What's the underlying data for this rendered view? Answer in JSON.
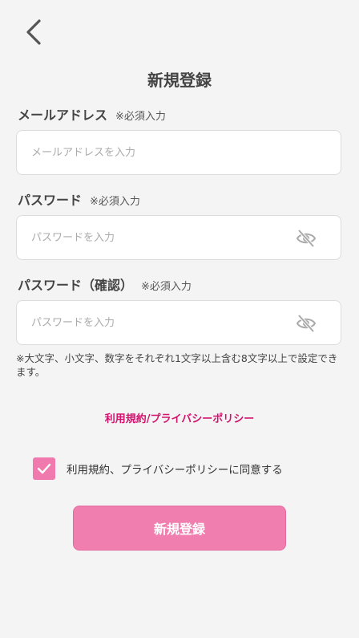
{
  "header": {
    "title": "新規登録"
  },
  "email": {
    "label": "メールアドレス",
    "required": "※必須入力",
    "placeholder": "メールアドレスを入力"
  },
  "password": {
    "label": "パスワード",
    "required": "※必須入力",
    "placeholder": "パスワードを入力"
  },
  "password_confirm": {
    "label": "パスワード（確認）",
    "required": "※必須入力",
    "placeholder": "パスワードを入力"
  },
  "note": "※大文字、小文字、数字をそれぞれ1文字以上含む8文字以上で設定できます。",
  "terms_link": "利用規約/プライバシーポリシー",
  "agree": {
    "checked": true,
    "label": "利用規約、プライバシーポリシーに同意する"
  },
  "submit_label": "新規登録",
  "icons": {
    "back": "chevron-left-icon",
    "hide_password": "eye-off-icon",
    "check": "check-icon"
  },
  "colors": {
    "accent": "#f07fb0",
    "link": "#d4136e",
    "background": "#f4f4f4"
  }
}
